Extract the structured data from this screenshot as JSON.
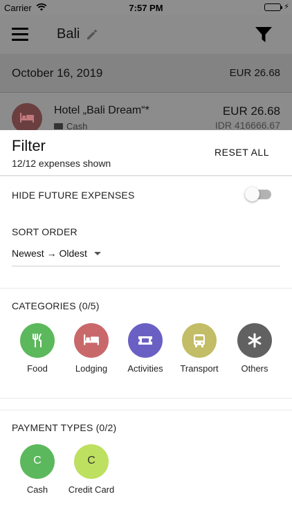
{
  "status_bar": {
    "carrier": "Carrier",
    "time": "7:57 PM",
    "battery_color": "#2fd158"
  },
  "app": {
    "trip_name": "Bali",
    "date": "October 16, 2019",
    "day_total": "EUR 26.68",
    "expense": {
      "name": "Hotel „Bali Dream“*",
      "payment": "Cash",
      "amount": "EUR 26.68",
      "amount_local": "IDR 416666.67",
      "icon": "bed-icon",
      "color": "#6b3f40"
    }
  },
  "filter": {
    "title": "Filter",
    "subtitle": "12/12 expenses shown",
    "reset_label": "RESET ALL",
    "hide_future_label": "HIDE FUTURE EXPENSES",
    "hide_future_enabled": false,
    "sort_label": "SORT ORDER",
    "sort_value": "Newest → Oldest",
    "categories_label": "CATEGORIES (0/5)",
    "categories": [
      {
        "label": "Food",
        "icon": "fork-knife-icon",
        "color": "#5cb85c"
      },
      {
        "label": "Lodging",
        "icon": "bed-icon",
        "color": "#c9686b"
      },
      {
        "label": "Activities",
        "icon": "ticket-icon",
        "color": "#6a60c4"
      },
      {
        "label": "Transport",
        "icon": "bus-icon",
        "color": "#c2bd66"
      },
      {
        "label": "Others",
        "icon": "asterisk-icon",
        "color": "#616161"
      }
    ],
    "payment_label": "PAYMENT TYPES (0/2)",
    "payment_types": [
      {
        "label": "Cash",
        "letter": "C",
        "color": "#5cb85c",
        "text_color": "#ffffff"
      },
      {
        "label": "Credit Card",
        "letter": "C",
        "color": "#bde060",
        "text_color": "#333333"
      }
    ]
  }
}
